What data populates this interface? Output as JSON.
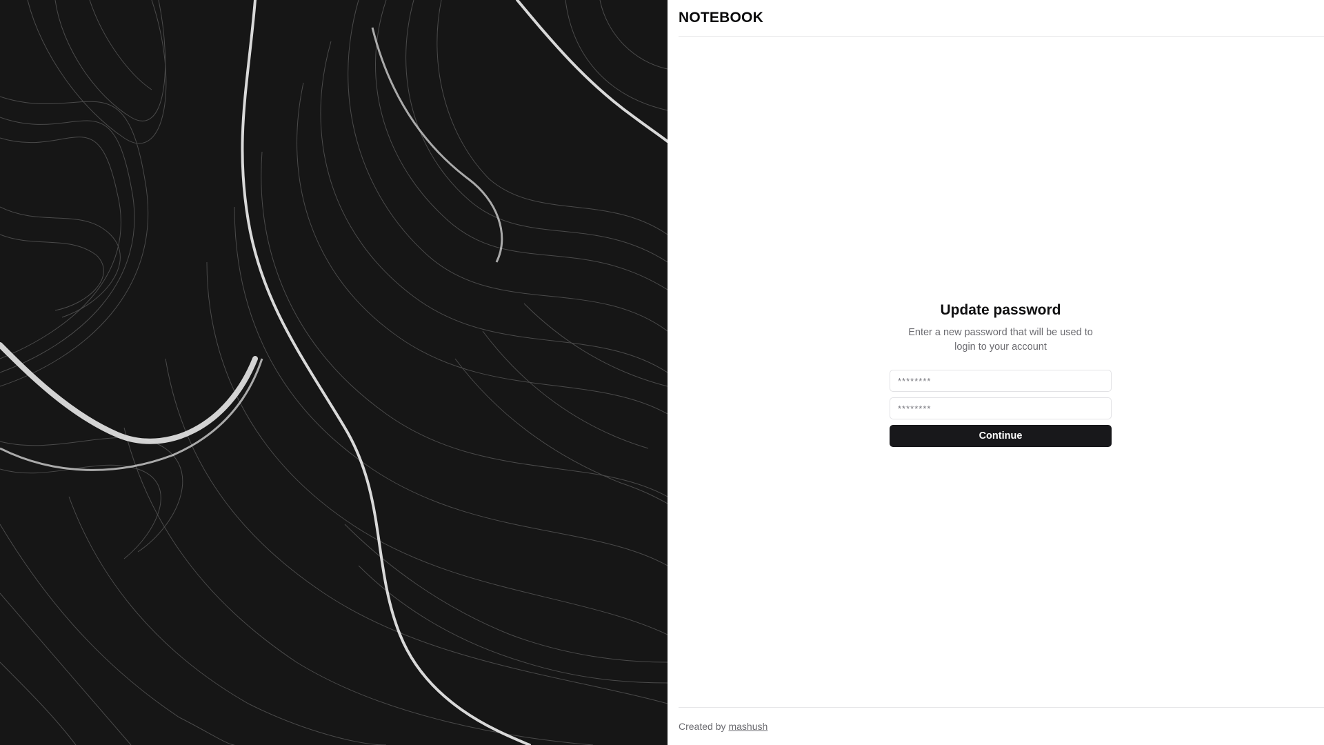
{
  "brand": {
    "name": "NOTEBOOK"
  },
  "form": {
    "title": "Update password",
    "subtitle": "Enter a new password that will be used to login to your account",
    "password_placeholder": "********",
    "confirm_placeholder": "********",
    "submit_label": "Continue"
  },
  "footer": {
    "prefix": "Created by",
    "author_link": "mashush"
  },
  "colors": {
    "button_bg": "#18181b",
    "hero_bg": "#1b1b1b"
  }
}
